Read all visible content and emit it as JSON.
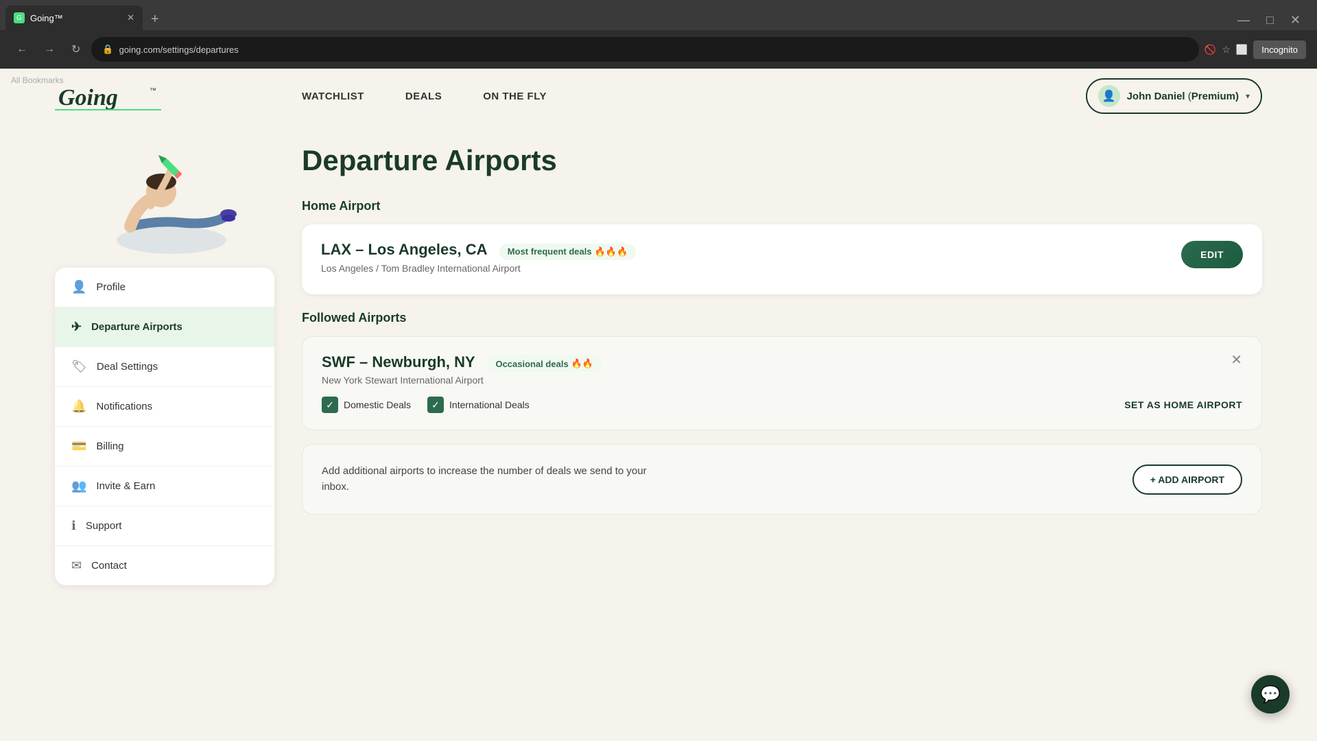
{
  "browser": {
    "tab_title": "Going™",
    "url": "going.com/settings/departures",
    "incognito_label": "Incognito",
    "bookmarks_label": "All Bookmarks"
  },
  "header": {
    "logo": "Going™",
    "logo_tm": "™",
    "nav": [
      {
        "label": "WATCHLIST",
        "id": "watchlist"
      },
      {
        "label": "DEALS",
        "id": "deals"
      },
      {
        "label": "ON THE FLY",
        "id": "on-the-fly"
      }
    ],
    "user": {
      "name": "John Daniel",
      "badge": "Premium",
      "chevron": "▾"
    }
  },
  "sidebar": {
    "items": [
      {
        "id": "profile",
        "label": "Profile",
        "icon": "👤",
        "active": false
      },
      {
        "id": "departure-airports",
        "label": "Departure Airports",
        "icon": "✈",
        "active": true
      },
      {
        "id": "deal-settings",
        "label": "Deal Settings",
        "icon": "🏷",
        "active": false
      },
      {
        "id": "notifications",
        "label": "Notifications",
        "icon": "🔔",
        "active": false
      },
      {
        "id": "billing",
        "label": "Billing",
        "icon": "💳",
        "active": false
      },
      {
        "id": "invite-earn",
        "label": "Invite & Earn",
        "icon": "👥",
        "active": false
      },
      {
        "id": "support",
        "label": "Support",
        "icon": "ℹ",
        "active": false
      },
      {
        "id": "contact",
        "label": "Contact",
        "icon": "✉",
        "active": false
      }
    ]
  },
  "page": {
    "title": "Departure Airports",
    "home_airport_section": "Home Airport",
    "followed_section": "Followed Airports",
    "home_airport": {
      "code": "LAX",
      "city": "Los Angeles, CA",
      "full_name": "Los Angeles / Tom Bradley International Airport",
      "deal_label": "Most frequent deals",
      "deal_emoji": "🔥🔥🔥",
      "edit_label": "EDIT"
    },
    "followed_airports": [
      {
        "code": "SWF",
        "city": "Newburgh, NY",
        "full_name": "New York Stewart International Airport",
        "deal_label": "Occasional deals",
        "deal_emoji": "🔥🔥",
        "domestic_deals": true,
        "international_deals": true,
        "domestic_label": "Domestic Deals",
        "international_label": "International Deals",
        "set_home_label": "SET AS HOME AIRPORT"
      }
    ],
    "add_airport": {
      "description": "Add additional airports to increase the number of deals we send to your inbox.",
      "button_label": "+ ADD AIRPORT"
    }
  },
  "chat": {
    "icon": "💬"
  }
}
